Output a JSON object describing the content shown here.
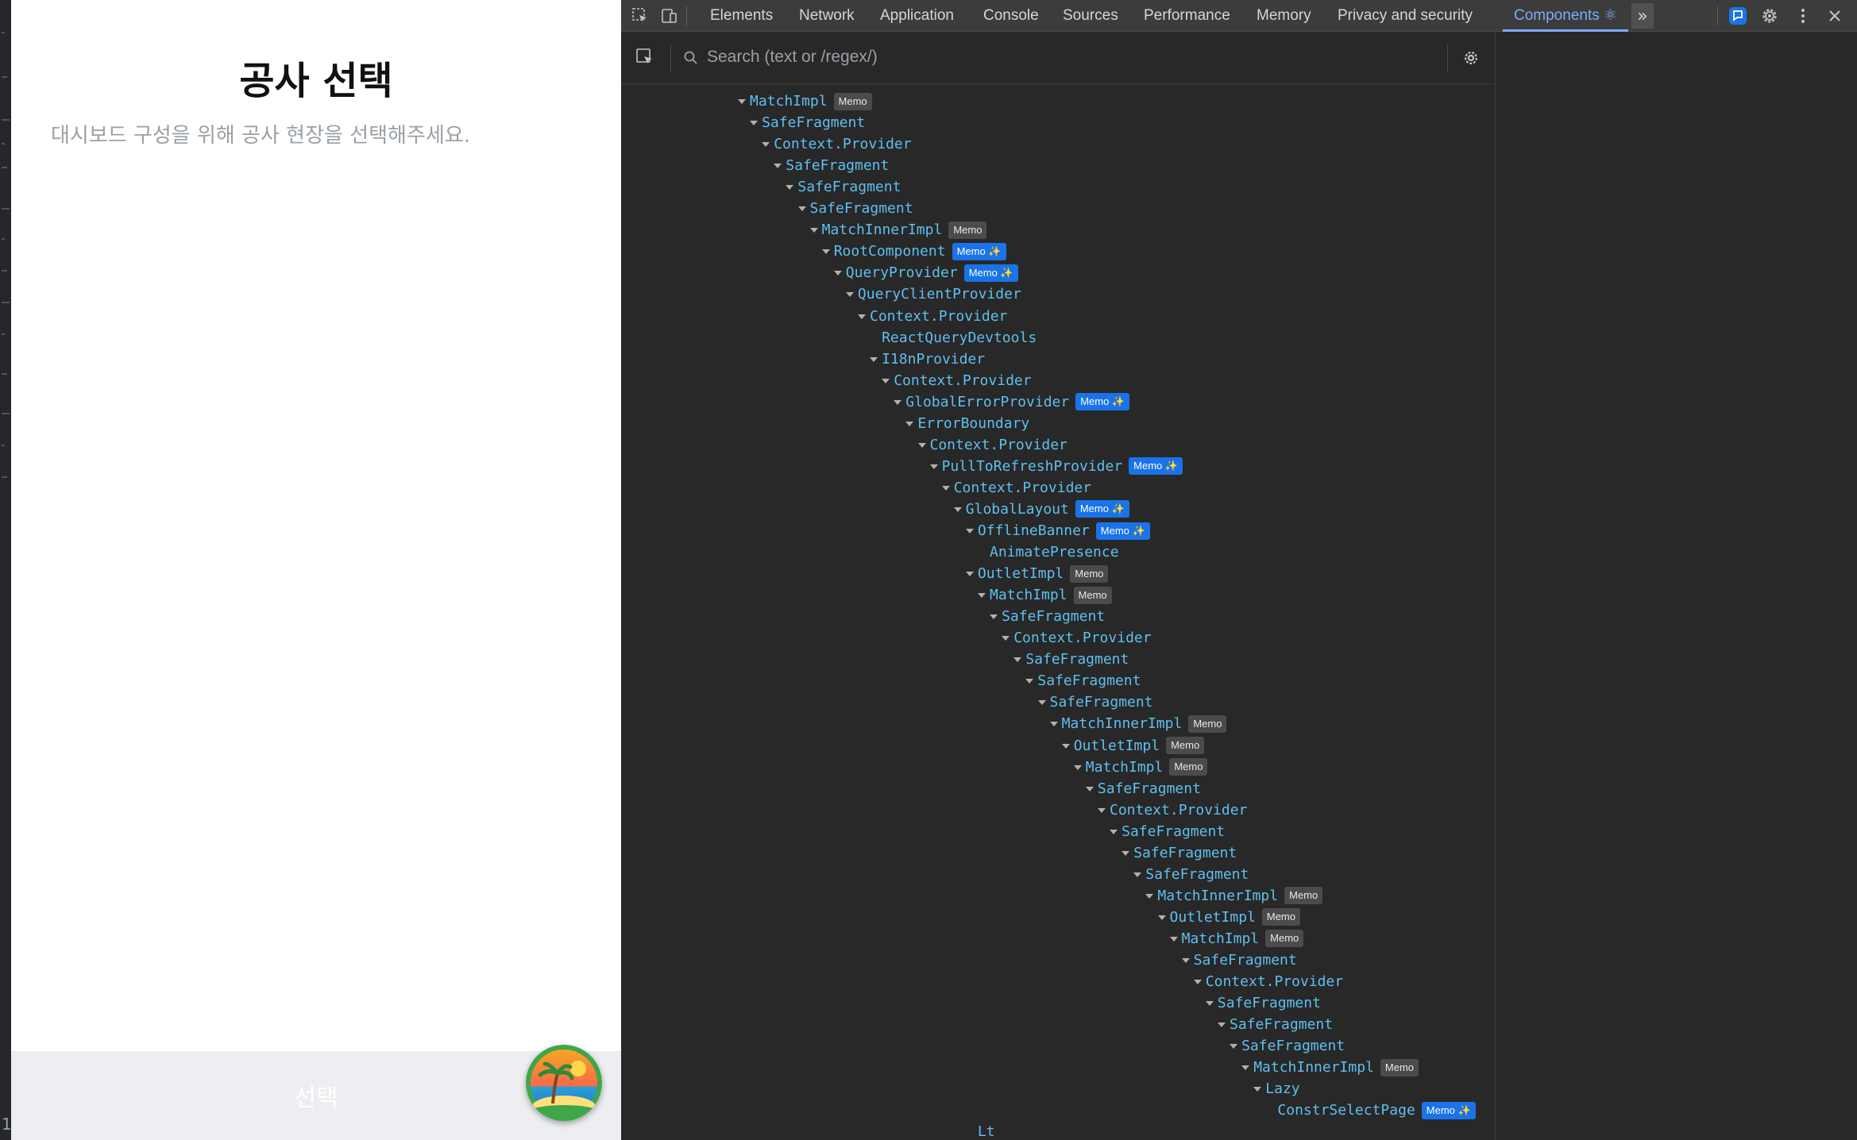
{
  "app": {
    "title": "공사 선택",
    "description": "대시보드 구성을 위해 공사 현장을 선택해주세요.",
    "select_button": "선택",
    "left_strip_number": "1"
  },
  "devtools": {
    "tabs": [
      {
        "label": "Elements"
      },
      {
        "label": "Network"
      },
      {
        "label": "Application"
      },
      {
        "label": "Console"
      },
      {
        "label": "Sources"
      },
      {
        "label": "Performance"
      },
      {
        "label": "Memory"
      },
      {
        "label": "Privacy and security"
      },
      {
        "label": "Components ⚛"
      }
    ],
    "active_tab": "Components ⚛",
    "more_tabs_label": "»",
    "search_placeholder": "Search (text or /regex/)",
    "accent_color": "#7cacf8",
    "component_color": "#5ebff0",
    "memo_badge": "Memo",
    "memo_forget_badge": "Memo ✨",
    "tree": [
      {
        "depth": 0,
        "name": "MatchImpl",
        "badge": "memo",
        "open": true
      },
      {
        "depth": 1,
        "name": "SafeFragment",
        "badge": null,
        "open": true
      },
      {
        "depth": 2,
        "name": "Context.Provider",
        "badge": null,
        "open": true
      },
      {
        "depth": 3,
        "name": "SafeFragment",
        "badge": null,
        "open": true
      },
      {
        "depth": 4,
        "name": "SafeFragment",
        "badge": null,
        "open": true
      },
      {
        "depth": 5,
        "name": "SafeFragment",
        "badge": null,
        "open": true
      },
      {
        "depth": 6,
        "name": "MatchInnerImpl",
        "badge": "memo",
        "open": true
      },
      {
        "depth": 7,
        "name": "RootComponent",
        "badge": "forget",
        "open": true
      },
      {
        "depth": 8,
        "name": "QueryProvider",
        "badge": "forget",
        "open": true
      },
      {
        "depth": 9,
        "name": "QueryClientProvider",
        "badge": null,
        "open": true
      },
      {
        "depth": 10,
        "name": "Context.Provider",
        "badge": null,
        "open": true
      },
      {
        "depth": 11,
        "name": "ReactQueryDevtools",
        "badge": null,
        "open": false
      },
      {
        "depth": 11,
        "name": "I18nProvider",
        "badge": null,
        "open": true
      },
      {
        "depth": 12,
        "name": "Context.Provider",
        "badge": null,
        "open": true
      },
      {
        "depth": 13,
        "name": "GlobalErrorProvider",
        "badge": "forget",
        "open": true
      },
      {
        "depth": 14,
        "name": "ErrorBoundary",
        "badge": null,
        "open": true
      },
      {
        "depth": 15,
        "name": "Context.Provider",
        "badge": null,
        "open": true
      },
      {
        "depth": 16,
        "name": "PullToRefreshProvider",
        "badge": "forget",
        "open": true
      },
      {
        "depth": 17,
        "name": "Context.Provider",
        "badge": null,
        "open": true
      },
      {
        "depth": 18,
        "name": "GlobalLayout",
        "badge": "forget",
        "open": true
      },
      {
        "depth": 19,
        "name": "OfflineBanner",
        "badge": "forget",
        "open": true
      },
      {
        "depth": 20,
        "name": "AnimatePresence",
        "badge": null,
        "open": false
      },
      {
        "depth": 19,
        "name": "OutletImpl",
        "badge": "memo",
        "open": true
      },
      {
        "depth": 20,
        "name": "MatchImpl",
        "badge": "memo",
        "open": true
      },
      {
        "depth": 21,
        "name": "SafeFragment",
        "badge": null,
        "open": true
      },
      {
        "depth": 22,
        "name": "Context.Provider",
        "badge": null,
        "open": true
      },
      {
        "depth": 23,
        "name": "SafeFragment",
        "badge": null,
        "open": true
      },
      {
        "depth": 24,
        "name": "SafeFragment",
        "badge": null,
        "open": true
      },
      {
        "depth": 25,
        "name": "SafeFragment",
        "badge": null,
        "open": true
      },
      {
        "depth": 26,
        "name": "MatchInnerImpl",
        "badge": "memo",
        "open": true
      },
      {
        "depth": 27,
        "name": "OutletImpl",
        "badge": "memo",
        "open": true
      },
      {
        "depth": 28,
        "name": "MatchImpl",
        "badge": "memo",
        "open": true
      },
      {
        "depth": 29,
        "name": "SafeFragment",
        "badge": null,
        "open": true
      },
      {
        "depth": 30,
        "name": "Context.Provider",
        "badge": null,
        "open": true
      },
      {
        "depth": 31,
        "name": "SafeFragment",
        "badge": null,
        "open": true
      },
      {
        "depth": 32,
        "name": "SafeFragment",
        "badge": null,
        "open": true
      },
      {
        "depth": 33,
        "name": "SafeFragment",
        "badge": null,
        "open": true
      },
      {
        "depth": 34,
        "name": "MatchInnerImpl",
        "badge": "memo",
        "open": true
      },
      {
        "depth": 35,
        "name": "OutletImpl",
        "badge": "memo",
        "open": true
      },
      {
        "depth": 36,
        "name": "MatchImpl",
        "badge": "memo",
        "open": true
      },
      {
        "depth": 37,
        "name": "SafeFragment",
        "badge": null,
        "open": true
      },
      {
        "depth": 38,
        "name": "Context.Provider",
        "badge": null,
        "open": true
      },
      {
        "depth": 39,
        "name": "SafeFragment",
        "badge": null,
        "open": true
      },
      {
        "depth": 40,
        "name": "SafeFragment",
        "badge": null,
        "open": true
      },
      {
        "depth": 41,
        "name": "SafeFragment",
        "badge": null,
        "open": true
      },
      {
        "depth": 42,
        "name": "MatchInnerImpl",
        "badge": "memo",
        "open": true
      },
      {
        "depth": 43,
        "name": "Lazy",
        "badge": null,
        "open": true
      },
      {
        "depth": 44,
        "name": "ConstrSelectPage",
        "badge": "forget",
        "open": false
      },
      {
        "depth": 19,
        "name": "Lt",
        "badge": null,
        "open": false
      }
    ]
  }
}
